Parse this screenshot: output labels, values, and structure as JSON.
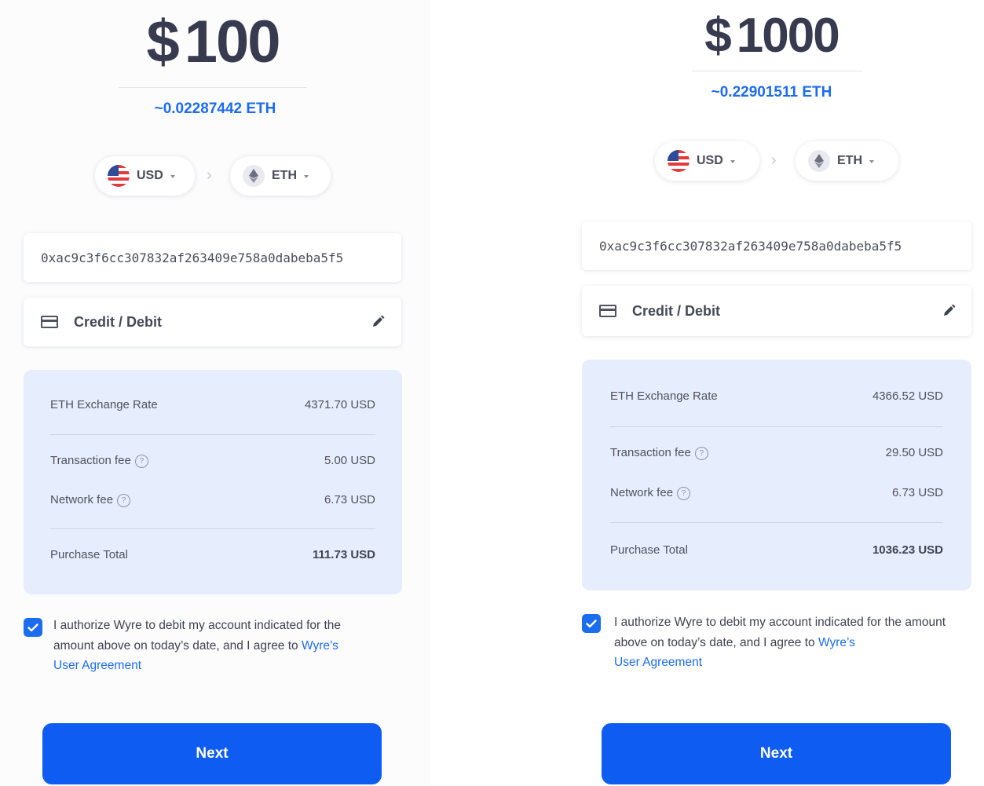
{
  "screens": [
    {
      "currency_symbol": "$",
      "amount": "100",
      "crypto_estimate": "~0.02287442 ETH",
      "from_currency": "USD",
      "to_currency": "ETH",
      "wallet_address": "0xac9c3f6cc307832af263409e758a0dabeba5f5",
      "payment_method": "Credit / Debit",
      "summary": {
        "rate_label": "ETH Exchange Rate",
        "rate_value": "4371.70 USD",
        "transaction_fee_label": "Transaction fee",
        "transaction_fee_value": "5.00 USD",
        "network_fee_label": "Network fee",
        "network_fee_value": "6.73 USD",
        "total_label": "Purchase Total",
        "total_value": "111.73 USD"
      },
      "consent": {
        "checked": true,
        "text": "I authorize Wyre to debit my account indicated for the amount above on today’s date, and I agree to ",
        "link_part1": "Wyre’s",
        "link_part2": "User Agreement"
      },
      "next_label": "Next"
    },
    {
      "currency_symbol": "$",
      "amount": "1000",
      "crypto_estimate": "~0.22901511 ETH",
      "from_currency": "USD",
      "to_currency": "ETH",
      "wallet_address": "0xac9c3f6cc307832af263409e758a0dabeba5f5",
      "payment_method": "Credit / Debit",
      "summary": {
        "rate_label": "ETH Exchange Rate",
        "rate_value": "4366.52 USD",
        "transaction_fee_label": "Transaction fee",
        "transaction_fee_value": "29.50 USD",
        "network_fee_label": "Network fee",
        "network_fee_value": "6.73 USD",
        "total_label": "Purchase Total",
        "total_value": "1036.23 USD"
      },
      "consent": {
        "checked": true,
        "text": "I authorize Wyre to debit my account indicated for the amount above on today’s date, and I agree to ",
        "link_part1": "Wyre’s",
        "link_part2": "User Agreement"
      },
      "next_label": "Next"
    }
  ],
  "icons": {
    "from_flag": "us-flag-icon",
    "to_token": "ethereum-icon",
    "separator": "chevron-right-icon",
    "dropdown": "caret-down-icon",
    "payment": "credit-card-icon",
    "edit": "pencil-icon",
    "help": "question-circle-icon",
    "checkbox": "checkmark-icon"
  },
  "colors": {
    "accent": "#1c6cf0",
    "button": "#0f5cf2",
    "summary_bg": "#e6edfc",
    "amount_text": "#383a4f"
  }
}
